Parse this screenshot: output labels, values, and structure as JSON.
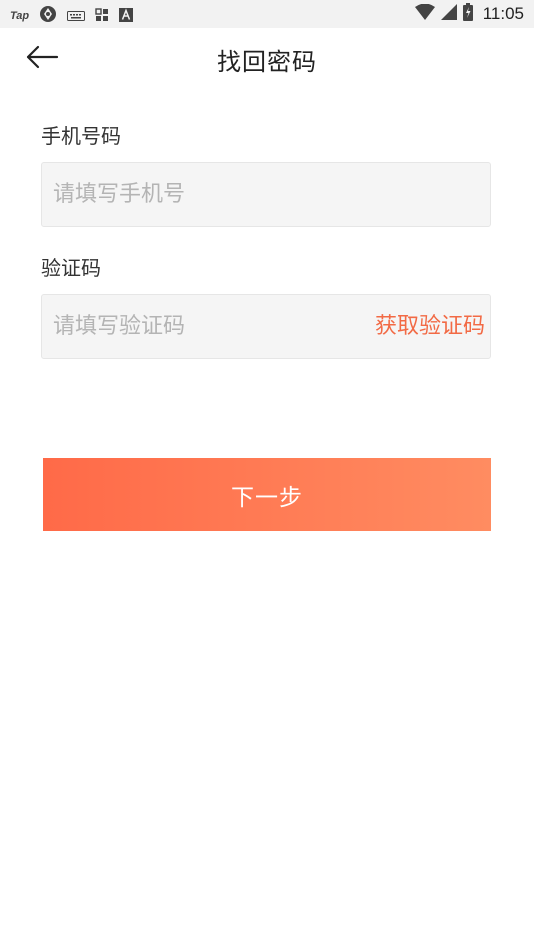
{
  "status_bar": {
    "left_text": "Tap",
    "time": "11:05",
    "icons": [
      "tap-logo",
      "vpn-icon",
      "keyboard-icon",
      "apps-icon",
      "font-icon",
      "wifi-icon",
      "signal-icon",
      "battery-icon"
    ]
  },
  "header": {
    "back_icon": "arrow-left-icon",
    "title": "找回密码"
  },
  "form": {
    "phone_label": "手机号码",
    "phone_placeholder": "请填写手机号",
    "phone_value": "",
    "code_label": "验证码",
    "code_placeholder": "请填写验证码",
    "code_value": "",
    "get_code_label": "获取验证码"
  },
  "actions": {
    "next_label": "下一步"
  },
  "colors": {
    "accent": "#f26a45",
    "button_gradient_start": "#ff6a48",
    "button_gradient_end": "#ff8c61"
  }
}
